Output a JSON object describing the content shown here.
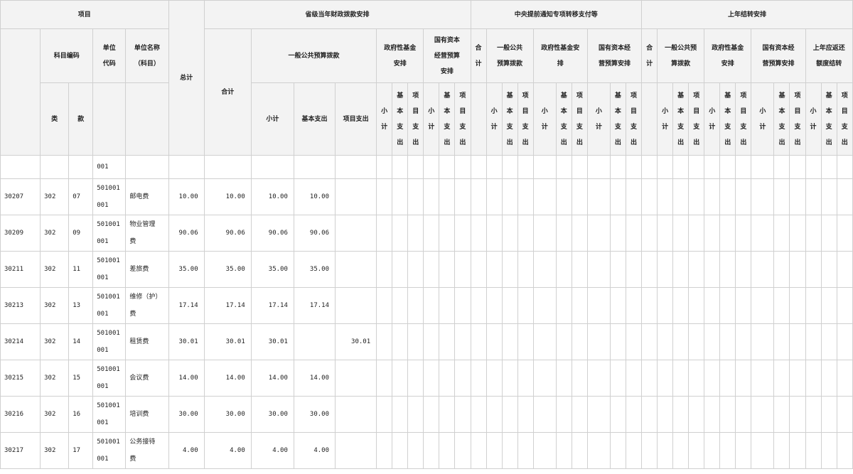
{
  "header": {
    "xiangmu": "项目",
    "zongji": "总计",
    "g1": "省级当年财政拨款安排",
    "g2": "中央提前通知专项转移支付等",
    "g3": "上年结转安排",
    "kemu_bianma": "科目编码",
    "danwei_daima": [
      "单位",
      "代码"
    ],
    "danwei_mingcheng": [
      "单位名称",
      "（科目）"
    ],
    "heji": "合计",
    "yiban_gonggong": "一般公共预算拨款",
    "zhengfu_jijin": [
      "政府性基金",
      "安排"
    ],
    "guoyou_ziben": [
      "国有资本",
      "经营预算",
      "安排"
    ],
    "g2_heji": [
      "合",
      "计"
    ],
    "g2_yiban": [
      "一般公共",
      "预算拨款"
    ],
    "g2_zhengfu": [
      "政府性基金安",
      "排"
    ],
    "g2_guoyou": [
      "国有资本经",
      "营预算安排"
    ],
    "g3_heji": [
      "合",
      "计"
    ],
    "g3_yiban": [
      "一般公共预",
      "算拨款"
    ],
    "g3_zhengfu": [
      "政府性基金",
      "安排"
    ],
    "g3_guoyou": [
      "国有资本经",
      "营预算安排"
    ],
    "g3_yinghuan": [
      "上年应返还",
      "额度结转"
    ],
    "lei": "类",
    "kuan": "款",
    "xiaoji": "小计",
    "jiben_zhichu": "基本支出",
    "xiangmu_zhichu": "项目支出",
    "sub_xiaoji": [
      "小",
      "计"
    ],
    "sub_jiben": [
      "基",
      "本",
      "支",
      "出"
    ],
    "sub_xiangmu": [
      "项",
      "目",
      "支",
      "出"
    ]
  },
  "partial_row": {
    "unit_code": "001"
  },
  "rows": [
    {
      "code": "30207",
      "lei": "302",
      "kuan": "07",
      "unit_code": [
        "501001",
        "001"
      ],
      "name": [
        "邮电费"
      ],
      "total": "10.00",
      "heji": "10.00",
      "xiaoji": "10.00",
      "jiben": "10.00",
      "xiangmu": ""
    },
    {
      "code": "30209",
      "lei": "302",
      "kuan": "09",
      "unit_code": [
        "501001",
        "001"
      ],
      "name": [
        "物业管理",
        "费"
      ],
      "total": "90.06",
      "heji": "90.06",
      "xiaoji": "90.06",
      "jiben": "90.06",
      "xiangmu": ""
    },
    {
      "code": "30211",
      "lei": "302",
      "kuan": "11",
      "unit_code": [
        "501001",
        "001"
      ],
      "name": [
        "差旅费"
      ],
      "total": "35.00",
      "heji": "35.00",
      "xiaoji": "35.00",
      "jiben": "35.00",
      "xiangmu": ""
    },
    {
      "code": "30213",
      "lei": "302",
      "kuan": "13",
      "unit_code": [
        "501001",
        "001"
      ],
      "name": [
        "维修（护）",
        "费"
      ],
      "total": "17.14",
      "heji": "17.14",
      "xiaoji": "17.14",
      "jiben": "17.14",
      "xiangmu": ""
    },
    {
      "code": "30214",
      "lei": "302",
      "kuan": "14",
      "unit_code": [
        "501001",
        "001"
      ],
      "name": [
        "租赁费"
      ],
      "total": "30.01",
      "heji": "30.01",
      "xiaoji": "30.01",
      "jiben": "",
      "xiangmu": "30.01"
    },
    {
      "code": "30215",
      "lei": "302",
      "kuan": "15",
      "unit_code": [
        "501001",
        "001"
      ],
      "name": [
        "会议费"
      ],
      "total": "14.00",
      "heji": "14.00",
      "xiaoji": "14.00",
      "jiben": "14.00",
      "xiangmu": ""
    },
    {
      "code": "30216",
      "lei": "302",
      "kuan": "16",
      "unit_code": [
        "501001",
        "001"
      ],
      "name": [
        "培训费"
      ],
      "total": "30.00",
      "heji": "30.00",
      "xiaoji": "30.00",
      "jiben": "30.00",
      "xiangmu": ""
    },
    {
      "code": "30217",
      "lei": "302",
      "kuan": "17",
      "unit_code": [
        "501001",
        "001"
      ],
      "name": [
        "公务接待",
        "费"
      ],
      "total": "4.00",
      "heji": "4.00",
      "xiaoji": "4.00",
      "jiben": "4.00",
      "xiangmu": ""
    }
  ]
}
